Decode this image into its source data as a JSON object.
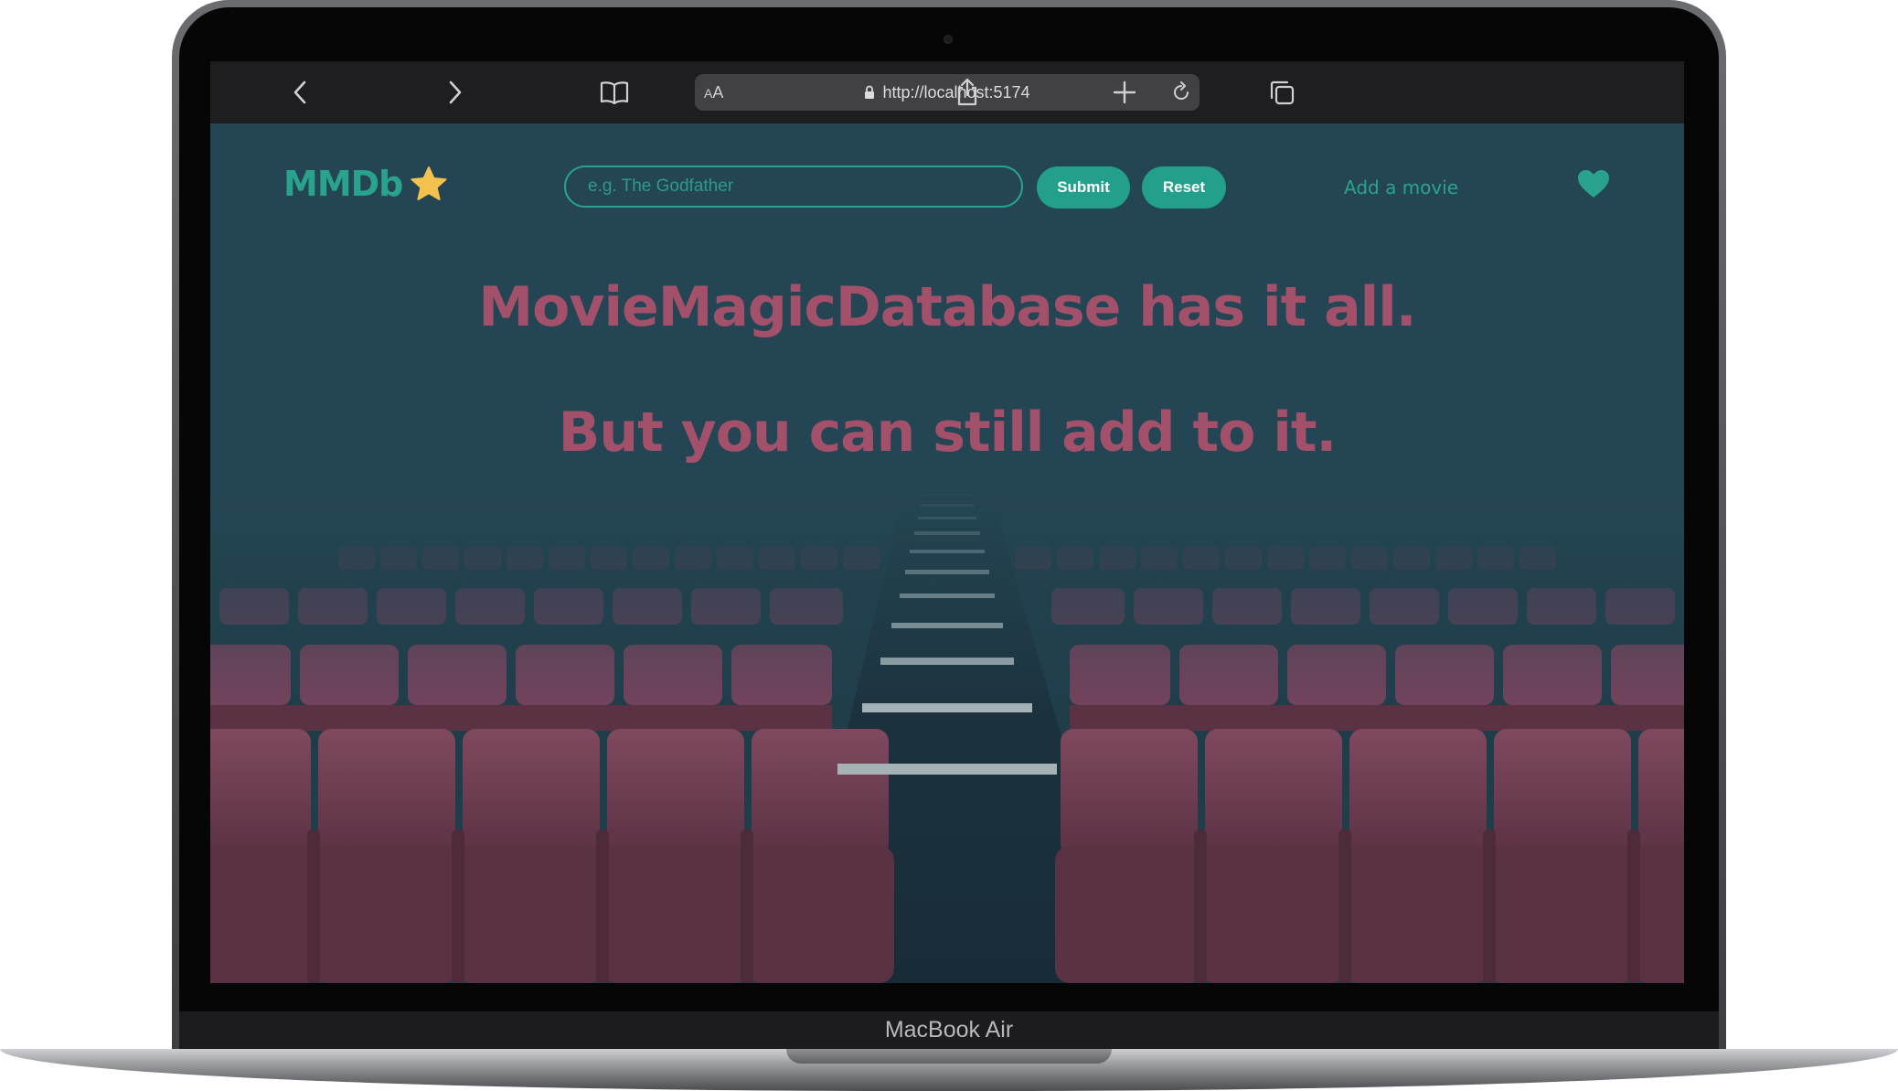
{
  "device": {
    "model_label": "MacBook Air"
  },
  "browser": {
    "text_size_label_large": "A",
    "text_size_label_small": "A",
    "url": "http://localhost:5174",
    "icons": {
      "back": "chevron-left-icon",
      "forward": "chevron-right-icon",
      "bookmarks": "book-icon",
      "lock": "lock-icon",
      "reload": "reload-icon",
      "share": "share-icon",
      "new_tab": "plus-icon",
      "tabs": "tabs-icon"
    }
  },
  "header": {
    "logo_text": "MMDb",
    "logo_icon": "star-icon",
    "search_placeholder": "e.g. The Godfather",
    "submit_label": "Submit",
    "reset_label": "Reset",
    "add_movie_label": "Add a movie",
    "favorites_icon": "heart-icon"
  },
  "hero": {
    "line1": "MovieMagicDatabase has it all.",
    "line2": "But you can still add to it."
  },
  "colors": {
    "page_background": "#244654",
    "accent": "#2aa38d",
    "hero_text": "#a3506a",
    "star": "#f2c14e",
    "seat": "#8a3a52"
  }
}
